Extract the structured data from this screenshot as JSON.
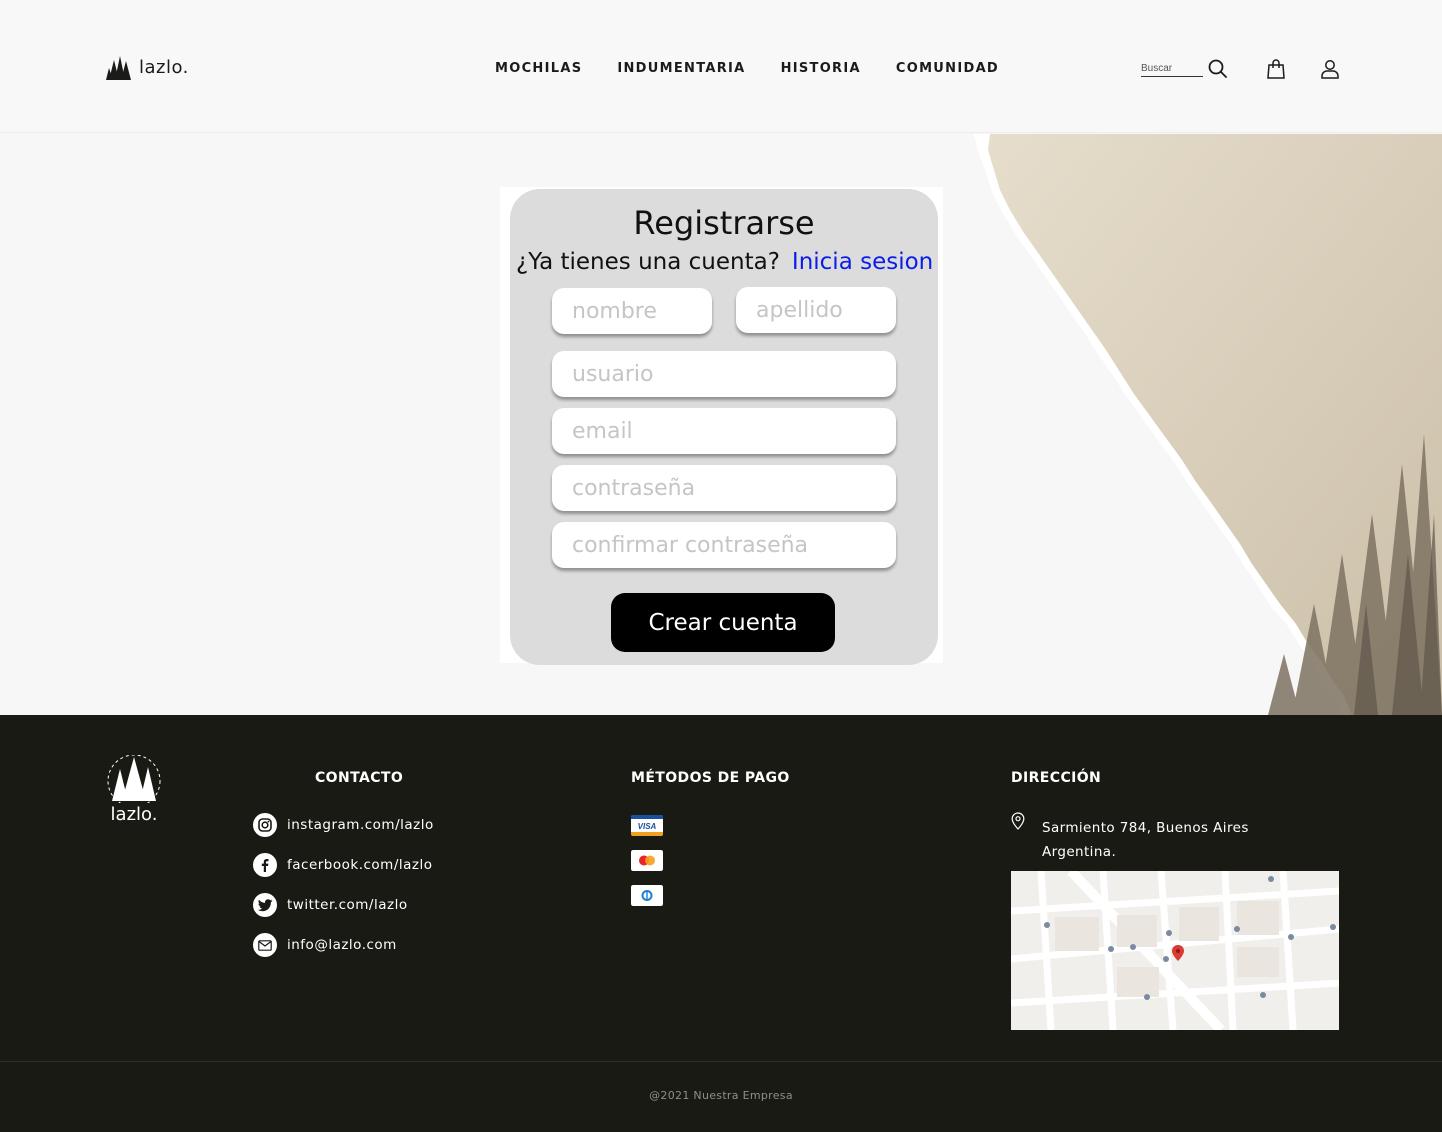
{
  "header": {
    "brand": "lazlo.",
    "nav": [
      "MOCHILAS",
      "INDUMENTARIA",
      "HISTORIA",
      "COMUNIDAD"
    ],
    "search_placeholder": "Buscar"
  },
  "form": {
    "title": "Registrarse",
    "have_account": "¿Ya tienes una cuenta?",
    "login_link": "Inicia sesion",
    "placeholders": {
      "nombre": "nombre",
      "apellido": "apellido",
      "usuario": "usuario",
      "email": "email",
      "password": "contraseña",
      "confirm": "confirmar contraseña"
    },
    "submit": "Crear cuenta"
  },
  "footer": {
    "brand": "lazlo.",
    "contact_heading": "CONTACTO",
    "contacts": [
      {
        "icon": "instagram-icon",
        "text": "instagram.com/lazlo"
      },
      {
        "icon": "facebook-icon",
        "text": "facerbook.com/lazlo"
      },
      {
        "icon": "twitter-icon",
        "text": "twitter.com/lazlo"
      },
      {
        "icon": "mail-icon",
        "text": "info@lazlo.com"
      }
    ],
    "payment_heading": "MÉTODOS DE PAGO",
    "payments": [
      "visa-icon",
      "mastercard-icon",
      "diners-icon"
    ],
    "address_heading": "DIRECCIÓN",
    "address": "Sarmiento 784, Buenos Aires Argentina.",
    "copyright": "@2021 Nuestra Empresa"
  },
  "colors": {
    "footer_bg": "#1a1a15",
    "link_blue": "#0b1de8",
    "button_bg": "#000000",
    "card_bg": "#dcdcdc"
  }
}
